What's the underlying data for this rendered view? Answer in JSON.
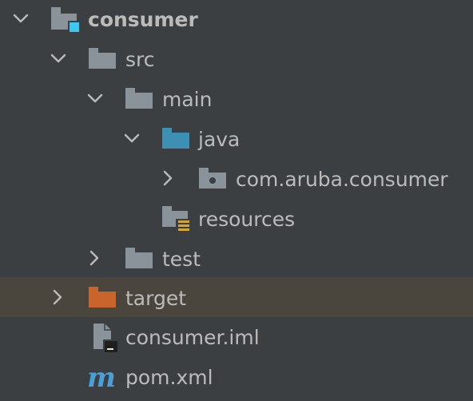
{
  "tree": {
    "root": {
      "label": "consumer",
      "icon": "module-folder-icon",
      "expanded": true
    },
    "src": {
      "label": "src",
      "icon": "folder-icon",
      "expanded": true
    },
    "main": {
      "label": "main",
      "icon": "folder-icon",
      "expanded": true
    },
    "java": {
      "label": "java",
      "icon": "source-root-folder-icon",
      "expanded": true
    },
    "package": {
      "label": "com.aruba.consumer",
      "icon": "package-icon",
      "expanded": false
    },
    "resources": {
      "label": "resources",
      "icon": "resources-folder-icon"
    },
    "test": {
      "label": "test",
      "icon": "folder-icon",
      "expanded": false
    },
    "target": {
      "label": "target",
      "icon": "excluded-folder-icon",
      "expanded": false,
      "selected": true
    },
    "iml": {
      "label": "consumer.iml",
      "icon": "iml-file-icon"
    },
    "pom": {
      "label": "pom.xml",
      "icon": "maven-icon"
    }
  },
  "colors": {
    "background": "#3c3f41",
    "selection": "#4a453d",
    "text": "#bbbbbb",
    "folder": "#8a9399",
    "source_root": "#3d8fb4",
    "excluded": "#c8642c",
    "module_badge": "#3ec7ef",
    "resources_badge": "#d4a532",
    "maven": "#4a9fd6"
  }
}
